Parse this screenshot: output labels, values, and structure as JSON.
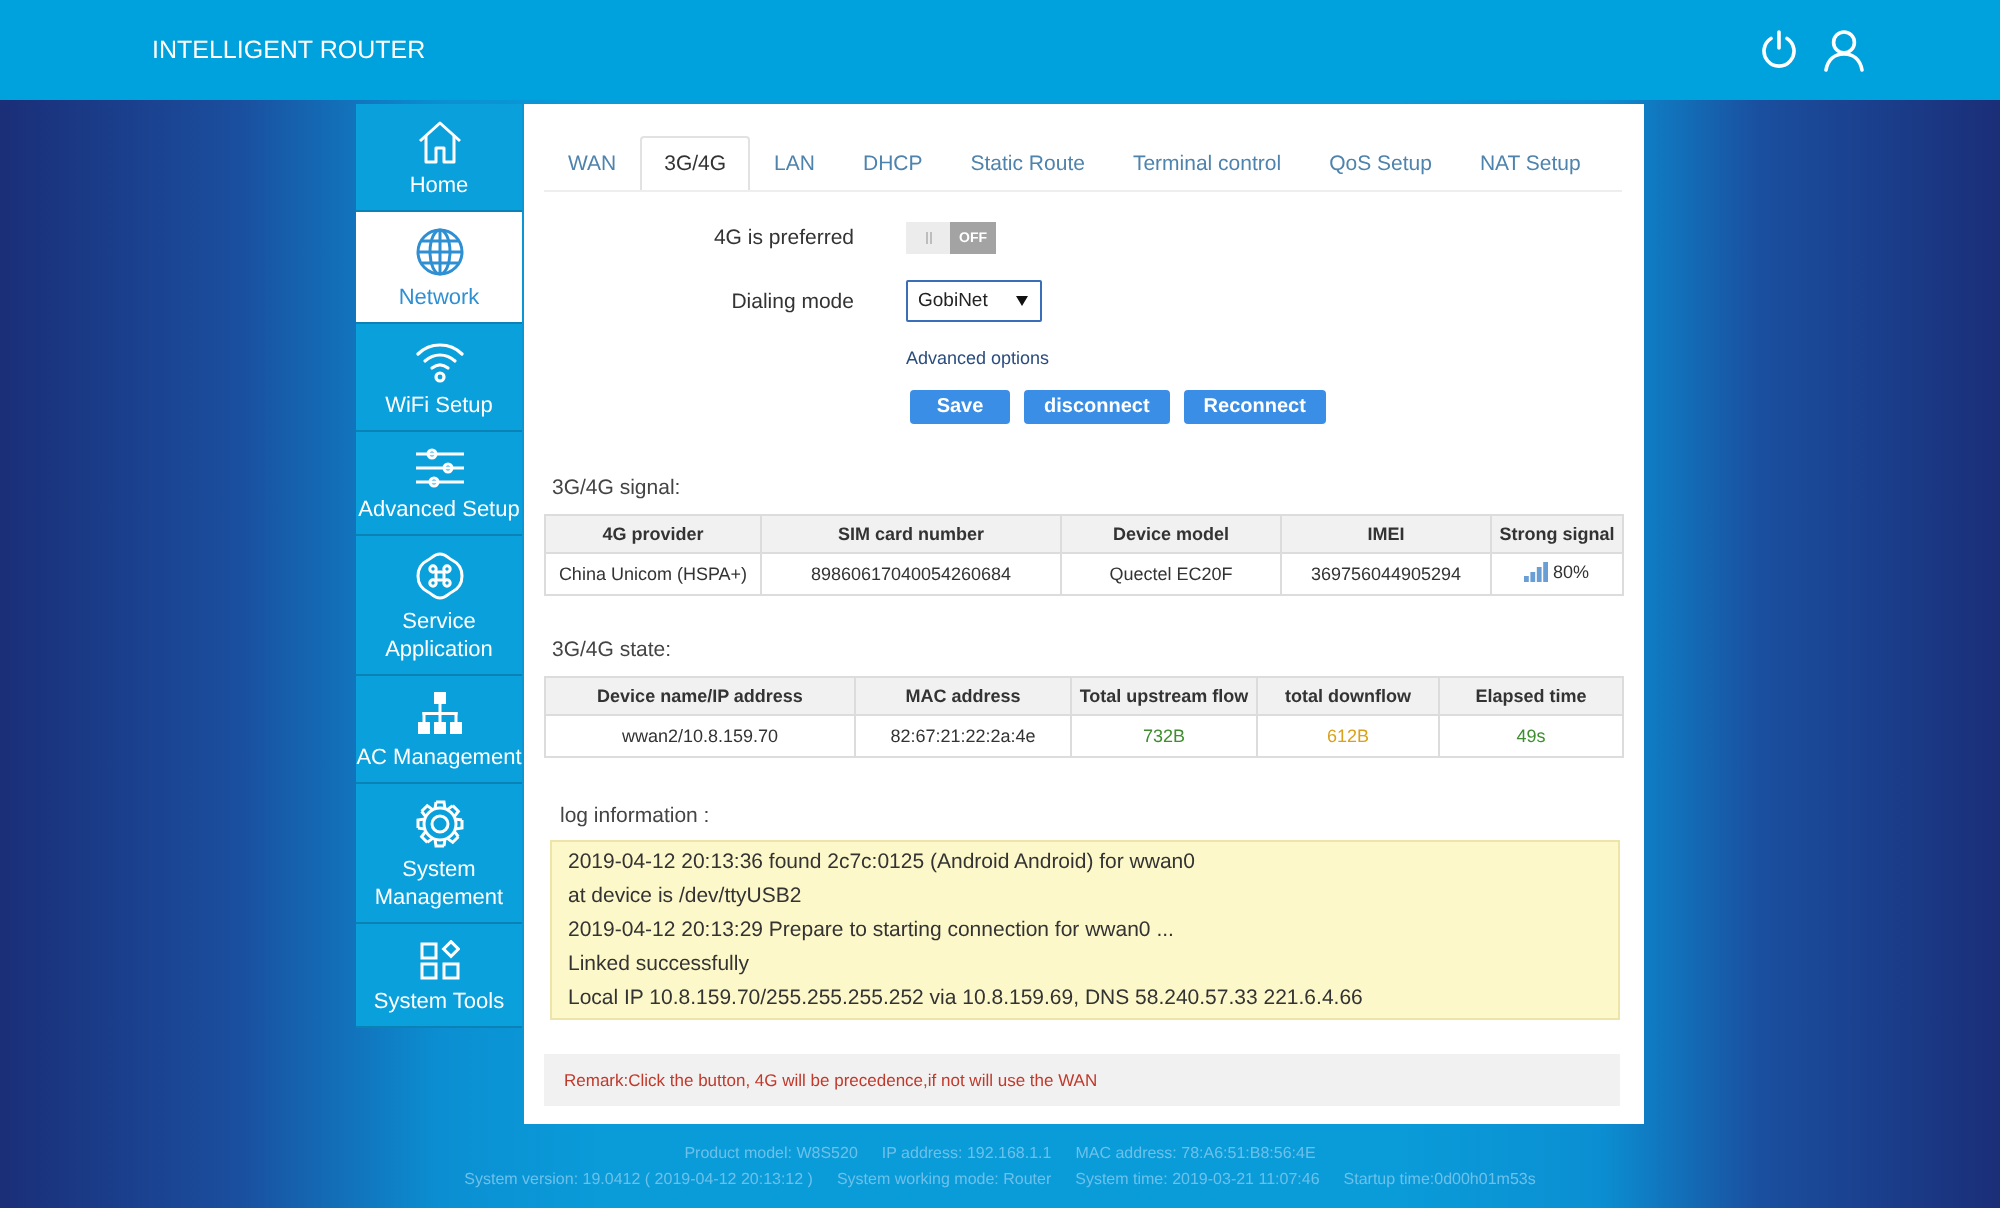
{
  "header": {
    "title": "INTELLIGENT ROUTER"
  },
  "sidebar": {
    "items": [
      {
        "label": "Home",
        "selected": false
      },
      {
        "label": "Network",
        "selected": true
      },
      {
        "label": "WiFi Setup",
        "selected": false
      },
      {
        "label": "Advanced Setup",
        "selected": false
      },
      {
        "label": "Service Application",
        "selected": false
      },
      {
        "label": "AC Management",
        "selected": false
      },
      {
        "label": "System Management",
        "selected": false
      },
      {
        "label": "System Tools",
        "selected": false
      }
    ]
  },
  "tabs": [
    {
      "label": "WAN",
      "selected": false
    },
    {
      "label": "3G/4G",
      "selected": true
    },
    {
      "label": "LAN",
      "selected": false
    },
    {
      "label": "DHCP",
      "selected": false
    },
    {
      "label": "Static Route",
      "selected": false
    },
    {
      "label": "Terminal control",
      "selected": false
    },
    {
      "label": "QoS Setup",
      "selected": false
    },
    {
      "label": "NAT Setup",
      "selected": false
    }
  ],
  "form": {
    "preferred_4g": {
      "label": "4G is preferred",
      "on": false,
      "state_text": "OFF"
    },
    "dialing_mode": {
      "label": "Dialing mode",
      "value": "GobiNet"
    },
    "advanced_link": "Advanced options",
    "buttons": [
      "Save",
      "disconnect",
      "Reconnect"
    ]
  },
  "signal": {
    "title": "3G/4G signal:",
    "columns": [
      {
        "label": "4G provider",
        "kind": "text"
      },
      {
        "label": "SIM card number",
        "kind": "text"
      },
      {
        "label": "Device model",
        "kind": "text"
      },
      {
        "label": "IMEI",
        "kind": "text"
      },
      {
        "label": "Strong signal",
        "kind": "signal"
      }
    ],
    "rows": [
      [
        "China Unicom (HSPA+)",
        "89860617040054260684",
        "Quectel EC20F",
        "369756044905294",
        "80%"
      ]
    ]
  },
  "state": {
    "title": "3G/4G state:",
    "columns": [
      "Device name/IP address",
      "MAC address",
      "Total upstream flow",
      "total downflow",
      "Elapsed time"
    ],
    "rows": [
      {
        "cells": [
          {
            "text": "wwan2/10.8.159.70"
          },
          {
            "text": "82:67:21:22:2a:4e"
          },
          {
            "text": "732B",
            "color": "#3e8e2f"
          },
          {
            "text": "612B",
            "color": "#d9a21b"
          },
          {
            "text": "49s",
            "color": "#3e8e2f"
          }
        ]
      }
    ]
  },
  "log": {
    "title": "log information :",
    "lines": [
      "2019-04-12 20:13:36 found 2c7c:0125 (Android Android) for wwan0",
      "at device is /dev/ttyUSB2",
      "2019-04-12 20:13:29 Prepare to starting connection for wwan0 ...",
      "Linked successfully",
      "Local IP 10.8.159.70/255.255.255.252 via 10.8.159.69, DNS 58.240.57.33 221.6.4.66"
    ]
  },
  "remark": "Remark:Click the button, 4G will be precedence,if not will use the WAN",
  "footer": {
    "rows": [
      [
        "Product model: W8S520",
        "IP address: 192.168.1.1",
        "MAC address: 78:A6:51:B8:56:4E"
      ],
      [
        "System version: 19.0412 ( 2019-04-12 20:13:12 )",
        "System working mode: Router",
        "System time: 2019-03-21 11:07:46",
        "Startup time:0d00h01m53s"
      ]
    ]
  }
}
